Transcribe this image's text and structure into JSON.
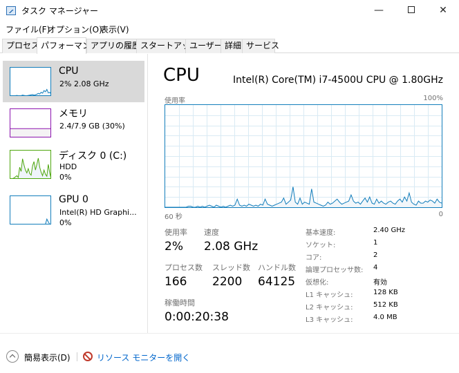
{
  "window": {
    "title": "タスク マネージャー",
    "controls": {
      "minimize": "—",
      "maximize": "",
      "close": "✕"
    }
  },
  "menu": [
    "ファイル(F)",
    "オプション(O)",
    "表示(V)"
  ],
  "tabs": [
    {
      "label": "プロセス",
      "active": false
    },
    {
      "label": "パフォーマンス",
      "active": true
    },
    {
      "label": "アプリの履歴",
      "active": false
    },
    {
      "label": "スタートアップ",
      "active": false
    },
    {
      "label": "ユーザー",
      "active": false
    },
    {
      "label": "詳細",
      "active": false
    },
    {
      "label": "サービス",
      "active": false
    }
  ],
  "sidebar": [
    {
      "name": "CPU",
      "detail": "2%  2.08 GHz",
      "detail2": "",
      "selected": true,
      "color": "#117dbb",
      "fill": "#f1f6fa",
      "history": [
        0,
        0,
        0,
        0,
        0,
        1,
        0,
        0,
        0,
        2,
        1,
        0,
        0,
        1,
        2,
        3,
        4,
        2,
        3,
        5,
        8,
        6,
        12,
        9,
        18,
        14,
        22,
        10,
        12,
        6
      ]
    },
    {
      "name": "メモリ",
      "detail": "2.4/7.9 GB (30%)",
      "detail2": "",
      "selected": false,
      "color": "#8b12ae",
      "fill": "#f4f2f4",
      "history": [
        30,
        30,
        30,
        30,
        30,
        30,
        30,
        30,
        30,
        30,
        30,
        30,
        30,
        30,
        30,
        30,
        30,
        30,
        30,
        30,
        30,
        30,
        30,
        30,
        30,
        30,
        30,
        30,
        30,
        30
      ]
    },
    {
      "name": "ディスク 0 (C:)",
      "detail": "HDD",
      "detail2": "0%",
      "selected": false,
      "color": "#4da60c",
      "fill": "#eff4fa",
      "history": [
        0,
        0,
        0,
        2,
        6,
        10,
        4,
        40,
        25,
        70,
        48,
        30,
        20,
        35,
        18,
        12,
        45,
        60,
        30,
        50,
        72,
        40,
        22,
        10,
        30,
        15,
        8,
        50,
        20,
        0
      ]
    },
    {
      "name": "GPU 0",
      "detail": "Intel(R) HD Graphi...",
      "detail2": "0%",
      "selected": false,
      "color": "#117dbb",
      "fill": "#f1f6fa",
      "history": [
        0,
        0,
        0,
        0,
        0,
        0,
        0,
        0,
        0,
        0,
        0,
        0,
        0,
        0,
        0,
        0,
        0,
        0,
        0,
        0,
        0,
        0,
        0,
        0,
        0,
        0,
        18,
        8,
        0,
        0
      ]
    }
  ],
  "cpu": {
    "title": "CPU",
    "model": "Intel(R) Core(TM) i7-4500U CPU @ 1.80GHz",
    "graph_label_left": "使用率",
    "graph_label_right": "100%",
    "axis_left": "60 秒",
    "axis_right": "0",
    "line_color": "#117dbb",
    "grid_color": "#d9eaf4",
    "usage_history": [
      0,
      0,
      0,
      0,
      0,
      0,
      0,
      0,
      0,
      0,
      1,
      1,
      0,
      0,
      1,
      0,
      1,
      0,
      1,
      2,
      1,
      0,
      2,
      1,
      0,
      1,
      0,
      1,
      2,
      1,
      2,
      8,
      2,
      1,
      2,
      1,
      3,
      2,
      1,
      2,
      1,
      3,
      2,
      8,
      3,
      2,
      1,
      2,
      3,
      4,
      5,
      9,
      3,
      5,
      7,
      20,
      5,
      3,
      9,
      3,
      5,
      4,
      3,
      18,
      5,
      4,
      3,
      2,
      1,
      2,
      5,
      3,
      4,
      6,
      8,
      5,
      3,
      4,
      5,
      6,
      12,
      6,
      4,
      5,
      3,
      6,
      9,
      5,
      10,
      4,
      3,
      8,
      4,
      6,
      4,
      3,
      5,
      6,
      4,
      3,
      6,
      8,
      5,
      10,
      6,
      14,
      5,
      3,
      2,
      6,
      4,
      4,
      6,
      5,
      7,
      6,
      4,
      8,
      5,
      4
    ]
  },
  "stats": {
    "usage": {
      "label": "使用率",
      "value": "2%"
    },
    "speed": {
      "label": "速度",
      "value": "2.08 GHz"
    },
    "processes": {
      "label": "プロセス数",
      "value": "166"
    },
    "threads": {
      "label": "スレッド数",
      "value": "2200"
    },
    "handles": {
      "label": "ハンドル数",
      "value": "64125"
    },
    "uptime": {
      "label": "稼働時間",
      "value": "0:00:20:38"
    }
  },
  "specs": [
    {
      "label": "基本速度:",
      "value": "2.40 GHz"
    },
    {
      "label": "ソケット:",
      "value": "1"
    },
    {
      "label": "コア:",
      "value": "2"
    },
    {
      "label": "論理プロセッサ数:",
      "value": "4"
    },
    {
      "label": "仮想化:",
      "value": "有効"
    },
    {
      "label": "L1 キャッシュ:",
      "value": "128 KB"
    },
    {
      "label": "L2 キャッシュ:",
      "value": "512 KB"
    },
    {
      "label": "L3 キャッシュ:",
      "value": "4.0 MB"
    }
  ],
  "footer": {
    "fewer_details": "簡易表示(D)",
    "resource_monitor": "リソース モニターを開く"
  }
}
